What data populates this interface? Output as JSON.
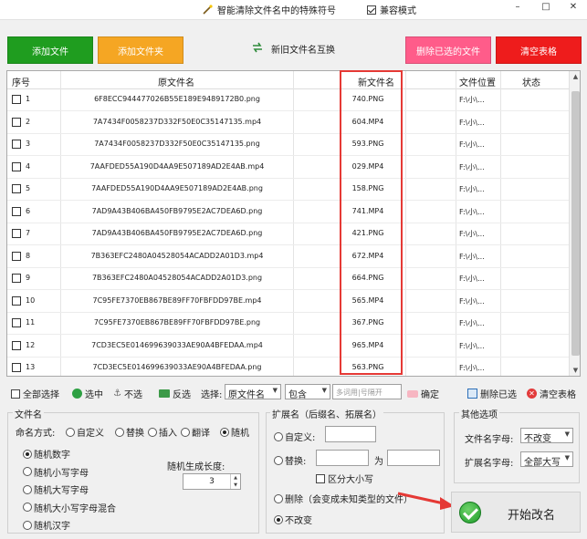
{
  "window": {
    "title": "智能清除文件名中的特殊符号",
    "compat_label": "兼容模式",
    "compat_checked": true,
    "controls": [
      "–",
      "□",
      "✕"
    ]
  },
  "toolbar": {
    "add_file": "添加文件",
    "add_folder": "添加文件夹",
    "swap_names": "新旧文件名互换",
    "delete_selected": "删除已选的文件",
    "clear_table": "清空表格",
    "colors": {
      "green": "#1f9d1f",
      "orange": "#f5a623",
      "pink": "#ff5c8a",
      "red": "#ee1c1c"
    }
  },
  "table": {
    "headers": [
      "序号",
      "原文件名",
      "新文件名",
      "文件位置",
      "状态"
    ],
    "rows": [
      {
        "no": "1",
        "original": "6F8ECC944477026B55E189E9489172B0.png",
        "new": "740.PNG",
        "location": "F:\\小\\..."
      },
      {
        "no": "2",
        "original": "7A7434F0058237D332F50E0C35147135.mp4",
        "new": "604.MP4",
        "location": "F:\\小\\..."
      },
      {
        "no": "3",
        "original": "7A7434F0058237D332F50E0C35147135.png",
        "new": "593.PNG",
        "location": "F:\\小\\..."
      },
      {
        "no": "4",
        "original": "7AAFDED55A190D4AA9E507189AD2E4AB.mp4",
        "new": "029.MP4",
        "location": "F:\\小\\..."
      },
      {
        "no": "5",
        "original": "7AAFDED55A190D4AA9E507189AD2E4AB.png",
        "new": "158.PNG",
        "location": "F:\\小\\..."
      },
      {
        "no": "6",
        "original": "7AD9A43B406BA450FB9795E2AC7DEA6D.png",
        "new": "741.MP4",
        "location": "F:\\小\\..."
      },
      {
        "no": "7",
        "original": "7AD9A43B406BA450FB9795E2AC7DEA6D.png",
        "new": "421.PNG",
        "location": "F:\\小\\..."
      },
      {
        "no": "8",
        "original": "7B363EFC2480A04528054ACADD2A01D3.mp4",
        "new": "672.MP4",
        "location": "F:\\小\\..."
      },
      {
        "no": "9",
        "original": "7B363EFC2480A04528054ACADD2A01D3.png",
        "new": "664.PNG",
        "location": "F:\\小\\..."
      },
      {
        "no": "10",
        "original": "7C95FE7370EB867BE89FF70FBFDD97BE.mp4",
        "new": "565.MP4",
        "location": "F:\\小\\..."
      },
      {
        "no": "11",
        "original": "7C95FE7370EB867BE89FF70FBFDD97BE.png",
        "new": "367.PNG",
        "location": "F:\\小\\..."
      },
      {
        "no": "12",
        "original": "7CD3EC5E014699639033AE90A4BFEDAA.mp4",
        "new": "965.MP4",
        "location": "F:\\小\\..."
      },
      {
        "no": "13",
        "original": "7CD3EC5E014699639033AE90A4BFEDAA.png",
        "new": "563.PNG",
        "location": "F:\\小\\..."
      }
    ]
  },
  "selection_bar": {
    "select_all": "全部选择",
    "select": "选中",
    "deselect": "不选",
    "invert": "反选",
    "choose_label": "选择:",
    "field_value": "原文件名",
    "match_value": "包含",
    "keyword_placeholder": "多词用|号隔开",
    "confirm": "确定",
    "delete_selected": "删除已选",
    "clear_table": "清空表格"
  },
  "filename_group": {
    "legend": "文件名",
    "naming_label": "命名方式:",
    "modes": [
      "自定义",
      "替换",
      "插入",
      "翻译",
      "随机"
    ],
    "selected_mode": "随机",
    "random_types": [
      "随机数字",
      "随机小写字母",
      "随机大写字母",
      "随机大小写字母混合",
      "随机汉字"
    ],
    "selected_random_type": "随机数字",
    "length_label": "随机生成长度:",
    "length_value": "3"
  },
  "extension_group": {
    "legend": "扩展名（后缀名、拓展名）",
    "custom_label": "自定义:",
    "replace_label": "替换:",
    "to_label": "为",
    "case_sensitive_label": "区分大小写",
    "delete_label": "删除（会变成未知类型的文件）",
    "no_change_label": "不改变",
    "selected": "不改变"
  },
  "other_group": {
    "legend": "其他选项",
    "filename_case_label": "文件名字母:",
    "filename_case_value": "不改变",
    "ext_case_label": "扩展名字母:",
    "ext_case_value": "全部大写"
  },
  "start": {
    "label": "开始改名"
  }
}
